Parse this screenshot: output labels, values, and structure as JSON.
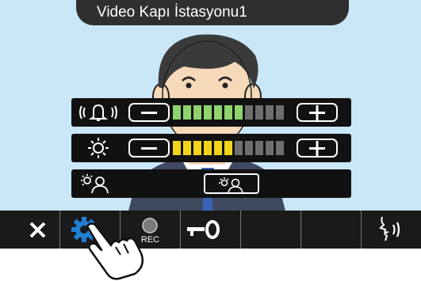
{
  "screen": {
    "title": "Video Kapı İstasyonu1"
  },
  "controls": {
    "volume": {
      "icon": "bell-volume-icon",
      "minus_icon": "minus-icon",
      "plus_icon": "plus-icon",
      "level": 7,
      "max": 11,
      "color": "#8fd36c"
    },
    "brightness": {
      "icon": "brightness-icon",
      "minus_icon": "minus-icon",
      "plus_icon": "plus-icon",
      "level": 6,
      "max": 11,
      "color": "#f2d31b"
    },
    "backlight": {
      "icon": "backlight-person-icon",
      "button_icon": "backlight-compensation-icon"
    }
  },
  "toolbar": {
    "items": [
      {
        "name": "close",
        "icon": "close-icon"
      },
      {
        "name": "settings",
        "icon": "gear-icon",
        "color": "#1f7fd3"
      },
      {
        "name": "record",
        "icon": "record-icon",
        "label": "REC"
      },
      {
        "name": "door-unlock",
        "icon": "key-icon"
      },
      {
        "name": "blank-1",
        "icon": ""
      },
      {
        "name": "blank-2",
        "icon": ""
      },
      {
        "name": "talk",
        "icon": "talk-icon"
      }
    ]
  },
  "colors": {
    "screen_bg": "#c9e7f7",
    "panel": "#111111",
    "meter_off": "#6e6e6e"
  }
}
